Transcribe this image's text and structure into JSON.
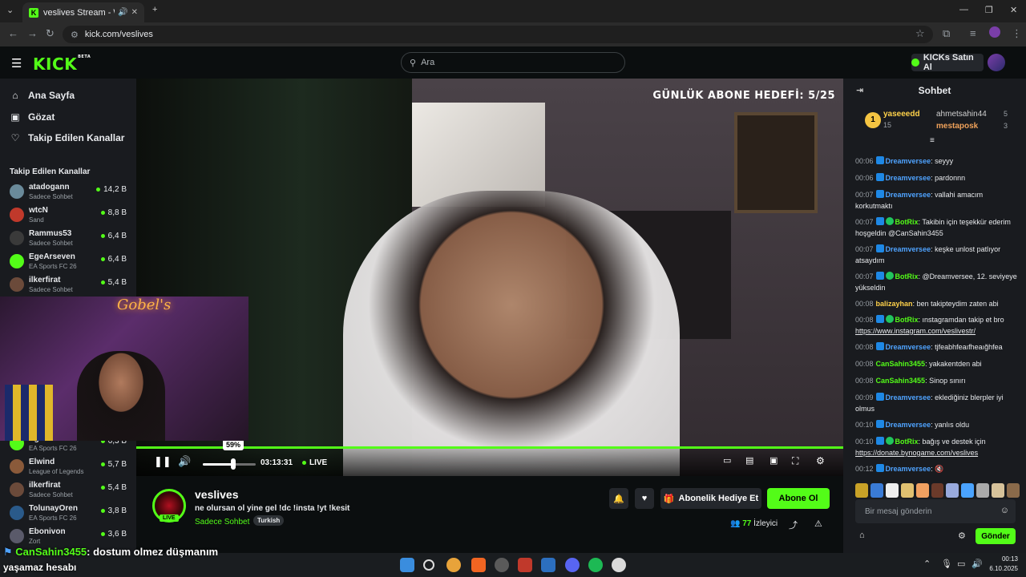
{
  "browser": {
    "tab_title": "veslives Stream - Watch Liv",
    "url": "kick.com/veslives"
  },
  "header": {
    "logo": "KICK",
    "logo_tag": "BETA",
    "search_placeholder": "Ara",
    "kicks_button": "KICKs Satın Al"
  },
  "sidebar": {
    "nav": [
      {
        "label": "Ana Sayfa",
        "icon": "home-icon"
      },
      {
        "label": "Gözat",
        "icon": "browse-icon"
      },
      {
        "label": "Takip Edilen Kanallar",
        "icon": "heart-icon"
      }
    ],
    "following_heading": "Takip Edilen Kanallar",
    "channels": [
      {
        "name": "atadogann",
        "category": "Sadece Sohbet",
        "viewers": "14,2 B",
        "color": "#6a8a9a"
      },
      {
        "name": "wtcN",
        "category": "Sand",
        "viewers": "8,8 B",
        "color": "#c0392b"
      },
      {
        "name": "Rammus53",
        "category": "Sadece Sohbet",
        "viewers": "6,4 B",
        "color": "#3a3a3a"
      },
      {
        "name": "EgeArseven",
        "category": "EA Sports FC 26",
        "viewers": "6,4 B",
        "color": "#53fc18"
      },
      {
        "name": "ilkerfirat",
        "category": "Sadece Sohbet",
        "viewers": "5,4 B",
        "color": "#6b4a3a"
      },
      {
        "name": "EgeArseven",
        "category": "EA Sports FC 26",
        "viewers": "6,3 B",
        "color": "#53fc18"
      },
      {
        "name": "Elwind",
        "category": "League of Legends",
        "viewers": "5,7 B",
        "color": "#8a5a3a"
      },
      {
        "name": "ilkerfirat",
        "category": "Sadece Sohbet",
        "viewers": "5,4 B",
        "color": "#6b4a3a"
      },
      {
        "name": "TolunayOren",
        "category": "EA Sports FC 26",
        "viewers": "3,8 B",
        "color": "#2a5a8a"
      },
      {
        "name": "Ebonivon",
        "category": "Zort",
        "viewers": "3,6 B",
        "color": "#5a5a6a"
      }
    ]
  },
  "player": {
    "goal_text": "GÜNLÜK ABONE HEDEFİ: 5/25",
    "volume_tooltip": "59%",
    "volume_level": 0.59,
    "elapsed": "03:13:31",
    "live_label": "LIVE",
    "pip_sign": "Gobel's"
  },
  "stream": {
    "channel": "veslives",
    "live_badge": "LIVE",
    "title": "ne olursan ol yine gel !dc !insta !yt !kesit",
    "category": "Sadece Sohbet",
    "tag": "Turkish",
    "gift_button": "Abonelik Hediye Et",
    "subscribe_button": "Abone Ol",
    "viewers_count": "77",
    "viewers_label": "İzleyici"
  },
  "chat": {
    "title": "Sohbet",
    "gifters": [
      {
        "rank": "1",
        "name": "yaseeedd",
        "count": "15"
      },
      {
        "name": "ahmetsahin44",
        "count": "5"
      },
      {
        "name": "mestaposk",
        "count": "3"
      }
    ],
    "messages": [
      {
        "time": "00:06",
        "user": "Dreamversee",
        "cls": "u",
        "badge": "badge",
        "text": "seyyy"
      },
      {
        "time": "00:06",
        "user": "Dreamversee",
        "cls": "u",
        "badge": "badge",
        "text": "pardonnn"
      },
      {
        "time": "00:07",
        "user": "Dreamversee",
        "cls": "u",
        "badge": "badge",
        "text": "vallahi amacım korkutmaktı"
      },
      {
        "time": "00:07",
        "user": "BotRix",
        "cls": "g",
        "badge": "both",
        "text": "Takibin için teşekkür ederim hoşgeldin @CanSahin3455"
      },
      {
        "time": "00:07",
        "user": "Dreamversee",
        "cls": "u",
        "badge": "badge",
        "text": "keşke unlost patlıyor atsaydım"
      },
      {
        "time": "00:07",
        "user": "BotRix",
        "cls": "g",
        "badge": "both",
        "text": "@Dreamversee, 12. seviyeye yükseldin"
      },
      {
        "time": "00:08",
        "user": "balizayhan",
        "cls": "y",
        "badge": "",
        "text": "ben takipteydim zaten abi"
      },
      {
        "time": "00:08",
        "user": "BotRix",
        "cls": "g",
        "badge": "both",
        "text": "ınstagramdan takip et bro",
        "link": "https://www.instagram.com/veslivestr/"
      },
      {
        "time": "00:08",
        "user": "Dreamversee",
        "cls": "u",
        "badge": "badge",
        "text": "tjfeabhfeaıfheaığhfea"
      },
      {
        "time": "00:08",
        "user": "CanSahin3455",
        "cls": "g",
        "badge": "",
        "text": "yakakentden abi"
      },
      {
        "time": "00:08",
        "user": "CanSahin3455",
        "cls": "g",
        "badge": "",
        "text": "Sinop sınırı"
      },
      {
        "time": "00:09",
        "user": "Dreamversee",
        "cls": "u",
        "badge": "badge",
        "text": "eklediğiniz blerpler iyi olmus"
      },
      {
        "time": "00:10",
        "user": "Dreamversee",
        "cls": "u",
        "badge": "badge",
        "text": "yanlıs oldu"
      },
      {
        "time": "00:10",
        "user": "BotRix",
        "cls": "g",
        "badge": "both",
        "text": "bağış ve destek için",
        "link": "https://donate.bynogame.com/veslives"
      },
      {
        "time": "00:12",
        "user": "Dreamversee",
        "cls": "u",
        "badge": "badge",
        "text": "🔇"
      }
    ],
    "input_placeholder": "Bir mesaj gönderin",
    "send_button": "Gönder"
  },
  "overlay": {
    "alert_user": "CanSahin3455",
    "alert_text": ": dostum olmez düşmanım",
    "alert_text2": "yaşamaz hesabı"
  },
  "taskbar": {
    "time": "00:13",
    "date": "6.10.2025"
  }
}
